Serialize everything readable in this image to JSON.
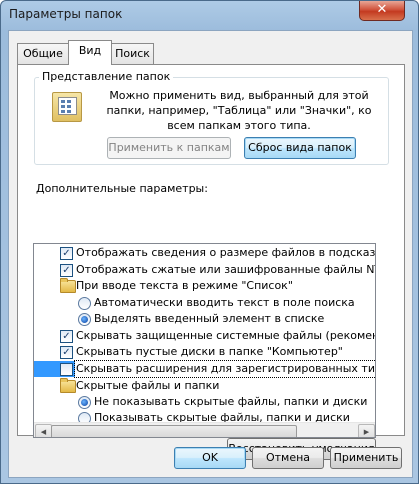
{
  "window": {
    "title": "Параметры папок",
    "close_glyph": "✕"
  },
  "tabs": [
    {
      "label": "Общие"
    },
    {
      "label": "Вид"
    },
    {
      "label": "Поиск"
    }
  ],
  "folder_views": {
    "label": "Представление папок",
    "description": "Можно применить вид, выбранный для этой папки, например, \"Таблица\" или \"Значки\", ко всем папкам этого типа.",
    "apply_button": "Применить к папкам",
    "reset_button": "Сброс вида папок"
  },
  "advanced": {
    "label": "Дополнительные параметры:",
    "items": [
      {
        "kind": "checkbox",
        "checked": true,
        "label": "Отображать сведения о размере файлов в подсказк"
      },
      {
        "kind": "checkbox",
        "checked": true,
        "label": "Отображать сжатые или зашифрованные файлы NTI"
      },
      {
        "kind": "folder",
        "label": "При вводе текста в режиме \"Список\""
      },
      {
        "kind": "radio",
        "checked": false,
        "label": "Автоматически вводить текст в поле поиска"
      },
      {
        "kind": "radio",
        "checked": true,
        "label": "Выделять введенный элемент в списке"
      },
      {
        "kind": "checkbox",
        "checked": true,
        "label": "Скрывать защищенные системные файлы (рекомен,"
      },
      {
        "kind": "checkbox",
        "checked": true,
        "label": "Скрывать пустые диски в папке \"Компьютер\""
      },
      {
        "kind": "checkbox",
        "checked": false,
        "label": "Скрывать расширения для зарегистрированных типо"
      },
      {
        "kind": "folder",
        "label": "Скрытые файлы и папки"
      },
      {
        "kind": "radio",
        "checked": true,
        "label": "Не показывать скрытые файлы, папки и диски"
      },
      {
        "kind": "radio",
        "checked": false,
        "label": "Показывать скрытые файлы, папки и диски"
      }
    ]
  },
  "restore_button": "Восстановить умолчания",
  "footer": {
    "ok": "OK",
    "cancel": "Отмена",
    "apply": "Применить"
  },
  "colors": {
    "selection": "#3399ff",
    "window_frame": "#9cbcdc",
    "close_button": "#c33a20"
  }
}
